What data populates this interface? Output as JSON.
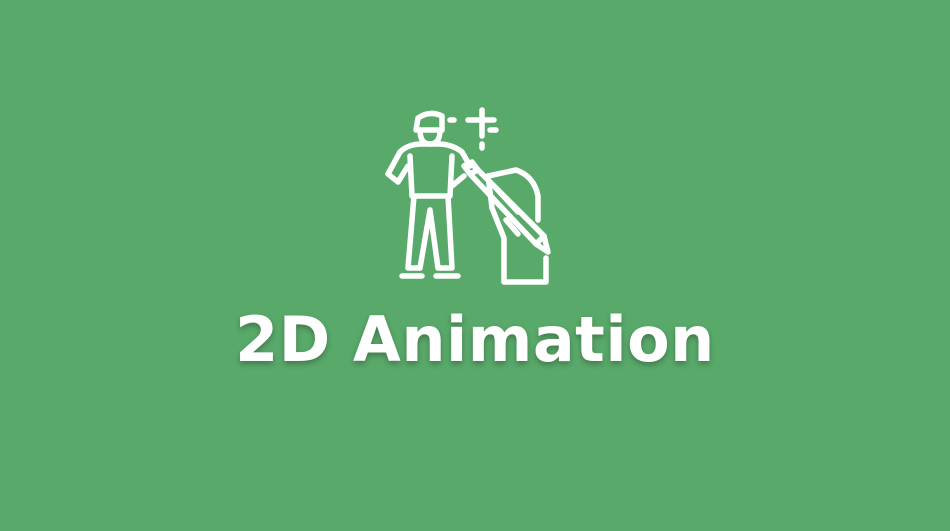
{
  "background_color": "#59a96a",
  "icon": {
    "name": "animator-with-stylus-icon",
    "color": "#ffffff"
  },
  "title": "2D Animation"
}
